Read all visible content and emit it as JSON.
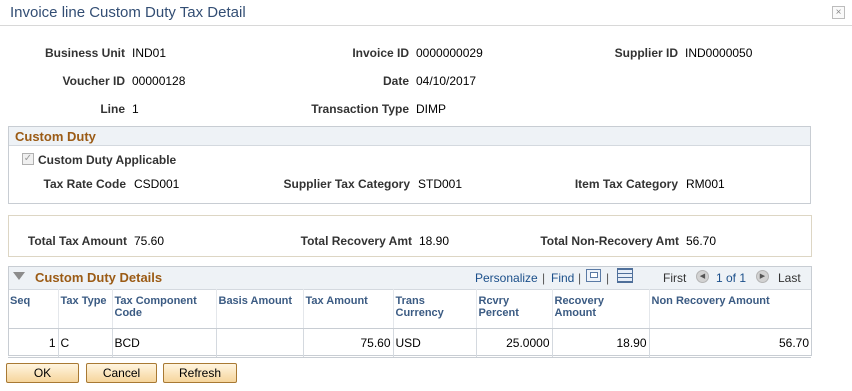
{
  "dialog": {
    "title": "Invoice line Custom Duty Tax Detail",
    "close_glyph": "×"
  },
  "header": {
    "business_unit_label": "Business Unit",
    "business_unit": "IND01",
    "invoice_id_label": "Invoice ID",
    "invoice_id": "0000000029",
    "supplier_id_label": "Supplier ID",
    "supplier_id": "IND0000050",
    "voucher_id_label": "Voucher ID",
    "voucher_id": "00000128",
    "date_label": "Date",
    "date": "04/10/2017",
    "line_label": "Line",
    "line": "1",
    "transaction_type_label": "Transaction Type",
    "transaction_type": "DIMP"
  },
  "custom_duty": {
    "title": "Custom Duty",
    "applicable_label": "Custom Duty Applicable",
    "applicable_checked": true,
    "tax_rate_code_label": "Tax Rate Code",
    "tax_rate_code": "CSD001",
    "supplier_tax_category_label": "Supplier Tax Category",
    "supplier_tax_category": "STD001",
    "item_tax_category_label": "Item Tax Category",
    "item_tax_category": "RM001"
  },
  "totals": {
    "total_tax_label": "Total Tax Amount",
    "total_tax": "75.60",
    "total_recovery_label": "Total Recovery Amt",
    "total_recovery": "18.90",
    "total_nonrecovery_label": "Total Non-Recovery Amt",
    "total_nonrecovery": "56.70"
  },
  "details_grid": {
    "title": "Custom Duty Details",
    "personalize": "Personalize",
    "find": "Find",
    "pipe": "|",
    "first": "First",
    "range": "1 of 1",
    "last": "Last",
    "columns": [
      "Seq",
      "Tax Type",
      "Tax Component Code",
      "Basis Amount",
      "Tax Amount",
      "Trans Currency",
      "Rcvry Percent",
      "Recovery Amount",
      "Non Recovery Amount"
    ],
    "rows": [
      [
        "1",
        "C",
        "BCD",
        "",
        "75.60",
        "USD",
        "25.0000",
        "18.90",
        "56.70"
      ]
    ]
  },
  "buttons": {
    "ok": "OK",
    "cancel": "Cancel",
    "refresh": "Refresh"
  },
  "colors": {
    "title_text": "#334e74",
    "section_title": "#9b5b15",
    "grid_header_bg": "#eef2f6",
    "button_border": "#a87933"
  }
}
